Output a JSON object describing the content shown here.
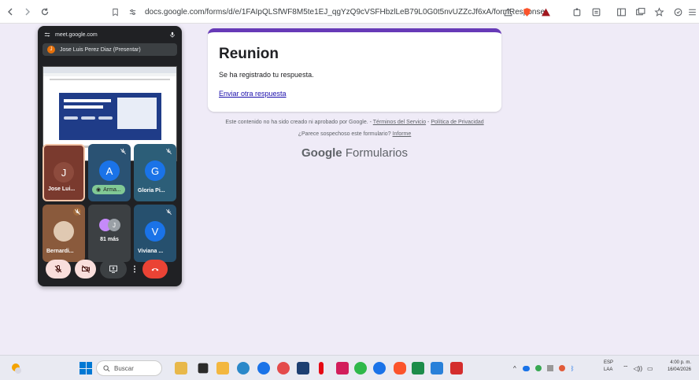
{
  "browser": {
    "url": "docs.google.com/forms/d/e/1FAIpQLSfWF8M5te1EJ_qgYzQ9cVSFHbzlLeB79L0G0t5nvUZZcJf6xA/formResponse",
    "back_icon": "chevron-left-icon",
    "forward_icon": "chevron-right-icon",
    "reload_icon": "reload-icon"
  },
  "form": {
    "title": "Reunion",
    "message": "Se ha registrado tu respuesta.",
    "link": "Enviar otra respuesta",
    "accent": "#673ab7",
    "disclaimer_prefix": "Este contenido no ha sido creado ni aprobado por Google. - ",
    "terms_link": "Términos del Servicio",
    "separator": " - ",
    "privacy_link": "Política de Privacidad",
    "suspicious_text": "¿Parece sospechoso este formulario? ",
    "report_link": "Informe",
    "brand_google": "Google",
    "brand_forms": "Formularios"
  },
  "meet": {
    "host": "meet.google.com",
    "presenter_initial": "J",
    "presenter": "Jose Luis Perez Diaz (Presentar)",
    "tiles": [
      {
        "initial": "J",
        "name": "Jose Lui..."
      },
      {
        "initial": "A",
        "name": "Arma..."
      },
      {
        "initial": "G",
        "name": "Gloria Pi..."
      },
      {
        "initial": "",
        "name": "Bernardi..."
      },
      {
        "initial": "J",
        "name": "81 más"
      },
      {
        "initial": "V",
        "name": "Viviana ..."
      }
    ]
  },
  "taskbar": {
    "search": "Buscar",
    "lang1": "ESP",
    "lang2": "LAA",
    "time": "4:00 p. m.",
    "date": "16/04/2026"
  }
}
